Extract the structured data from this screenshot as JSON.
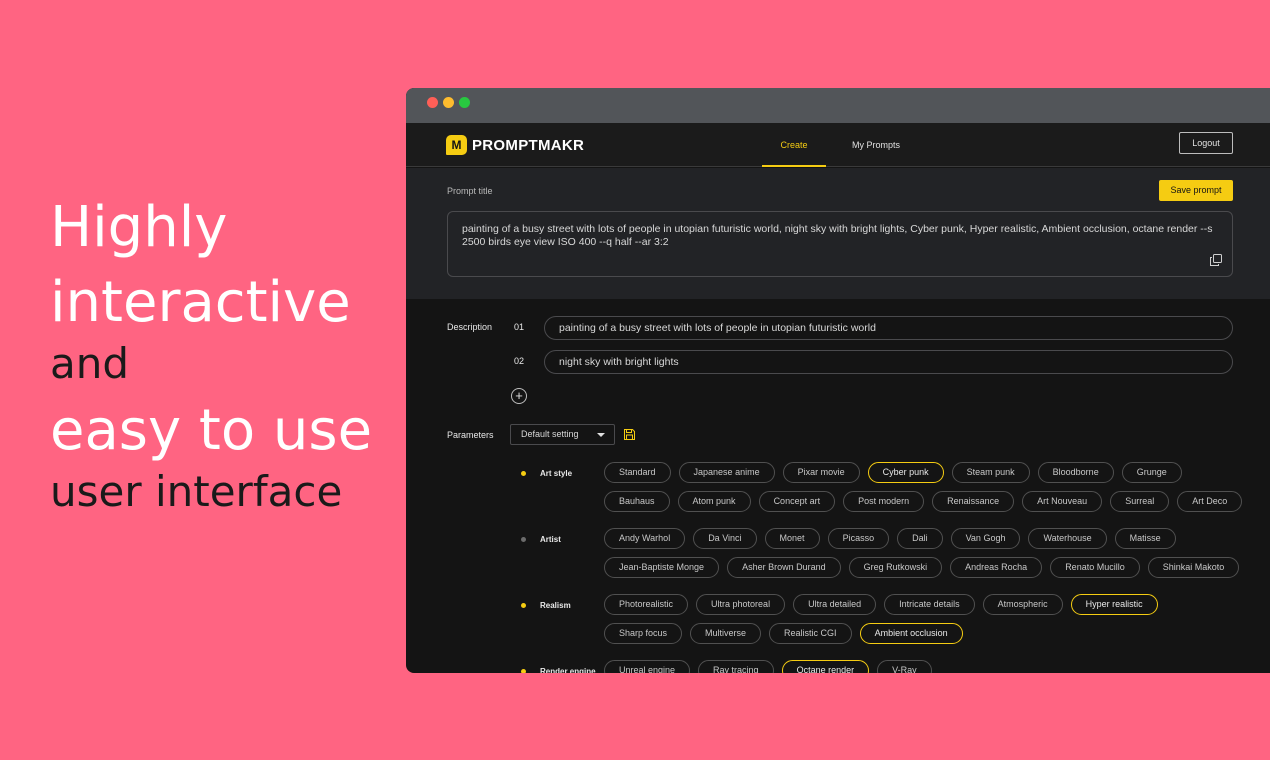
{
  "hero": {
    "line1": "Highly",
    "line2": "interactive",
    "line3": "and",
    "line4": "easy to use",
    "line5": "user interface"
  },
  "app": {
    "logo_text": "PROMPTMAKR",
    "logo_mark": "M",
    "nav": [
      {
        "label": "Create",
        "active": true
      },
      {
        "label": "My Prompts",
        "active": false
      }
    ],
    "logout_label": "Logout"
  },
  "prompt": {
    "title_label": "Prompt title",
    "save_label": "Save prompt",
    "text": "painting of a busy street with lots of people in utopian futuristic world, night sky with bright lights, Cyber punk, Hyper realistic, Ambient occlusion, octane render --s 2500 birds eye view ISO 400 --q half --ar 3:2"
  },
  "description": {
    "label": "Description",
    "items": [
      {
        "num": "01",
        "value": "painting of a busy street with lots of people in utopian futuristic world"
      },
      {
        "num": "02",
        "value": "night sky with bright lights"
      }
    ],
    "add_label": "+"
  },
  "parameters": {
    "label": "Parameters",
    "preset": "Default setting",
    "categories": [
      {
        "label": "Art style",
        "dot": "#f5cc12",
        "rows": [
          [
            {
              "label": "Standard",
              "selected": false
            },
            {
              "label": "Japanese anime",
              "selected": false
            },
            {
              "label": "Pixar movie",
              "selected": false
            },
            {
              "label": "Cyber punk",
              "selected": true
            },
            {
              "label": "Steam punk",
              "selected": false
            },
            {
              "label": "Bloodborne",
              "selected": false
            },
            {
              "label": "Grunge",
              "selected": false
            }
          ],
          [
            {
              "label": "Bauhaus",
              "selected": false
            },
            {
              "label": "Atom punk",
              "selected": false
            },
            {
              "label": "Concept art",
              "selected": false
            },
            {
              "label": "Post modern",
              "selected": false
            },
            {
              "label": "Renaissance",
              "selected": false
            },
            {
              "label": "Art Nouveau",
              "selected": false
            },
            {
              "label": "Surreal",
              "selected": false
            },
            {
              "label": "Art Deco",
              "selected": false
            }
          ]
        ]
      },
      {
        "label": "Artist",
        "dot": "#6b6b6b",
        "rows": [
          [
            {
              "label": "Andy Warhol",
              "selected": false
            },
            {
              "label": "Da Vinci",
              "selected": false
            },
            {
              "label": "Monet",
              "selected": false
            },
            {
              "label": "Picasso",
              "selected": false
            },
            {
              "label": "Dali",
              "selected": false
            },
            {
              "label": "Van Gogh",
              "selected": false
            },
            {
              "label": "Waterhouse",
              "selected": false
            },
            {
              "label": "Matisse",
              "selected": false
            }
          ],
          [
            {
              "label": "Jean-Baptiste Monge",
              "selected": false
            },
            {
              "label": "Asher Brown Durand",
              "selected": false
            },
            {
              "label": "Greg Rutkowski",
              "selected": false
            },
            {
              "label": "Andreas Rocha",
              "selected": false
            },
            {
              "label": "Renato Mucillo",
              "selected": false
            },
            {
              "label": "Shinkai Makoto",
              "selected": false
            }
          ]
        ]
      },
      {
        "label": "Realism",
        "dot": "#f5cc12",
        "rows": [
          [
            {
              "label": "Photorealistic",
              "selected": false
            },
            {
              "label": "Ultra photoreal",
              "selected": false
            },
            {
              "label": "Ultra detailed",
              "selected": false
            },
            {
              "label": "Intricate details",
              "selected": false
            },
            {
              "label": "Atmospheric",
              "selected": false
            },
            {
              "label": "Hyper realistic",
              "selected": true
            }
          ],
          [
            {
              "label": "Sharp focus",
              "selected": false
            },
            {
              "label": "Multiverse",
              "selected": false
            },
            {
              "label": "Realistic CGI",
              "selected": false
            },
            {
              "label": "Ambient occlusion",
              "selected": true
            }
          ]
        ]
      },
      {
        "label": "Render engine",
        "dot": "#f5cc12",
        "rows": [
          [
            {
              "label": "Unreal engine",
              "selected": false
            },
            {
              "label": "Ray tracing",
              "selected": false
            },
            {
              "label": "Octane render",
              "selected": true
            },
            {
              "label": "V-Ray",
              "selected": false
            }
          ]
        ]
      }
    ]
  },
  "colors": {
    "background": "#ff6482",
    "accent": "#f5cc12",
    "app_bg": "#141414"
  }
}
